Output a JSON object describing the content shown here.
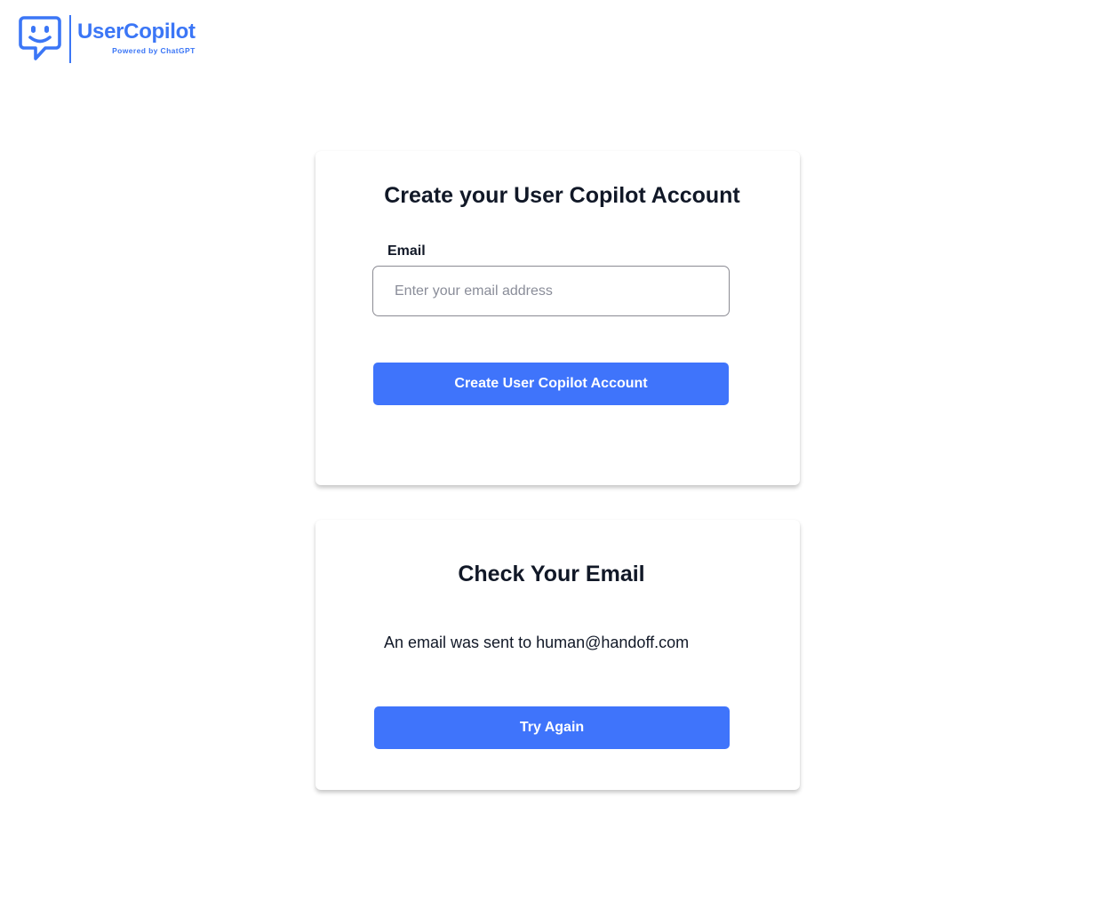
{
  "brand": {
    "name": "UserCopilot",
    "tagline": "Powered by ChatGPT",
    "color": "#3b76f6",
    "icon": "chat-bubble-smiley-icon"
  },
  "signup_card": {
    "title": "Create your User Copilot Account",
    "email_label": "Email",
    "email_value": "",
    "email_placeholder": "Enter your email address",
    "submit_label": "Create User Copilot Account"
  },
  "confirmation_card": {
    "title": "Check Your Email",
    "message": "An email was sent to human@handoff.com",
    "retry_label": "Try Again"
  },
  "colors": {
    "button": "#3f74fb",
    "text": "#111827",
    "placeholder": "#8a8d99"
  }
}
